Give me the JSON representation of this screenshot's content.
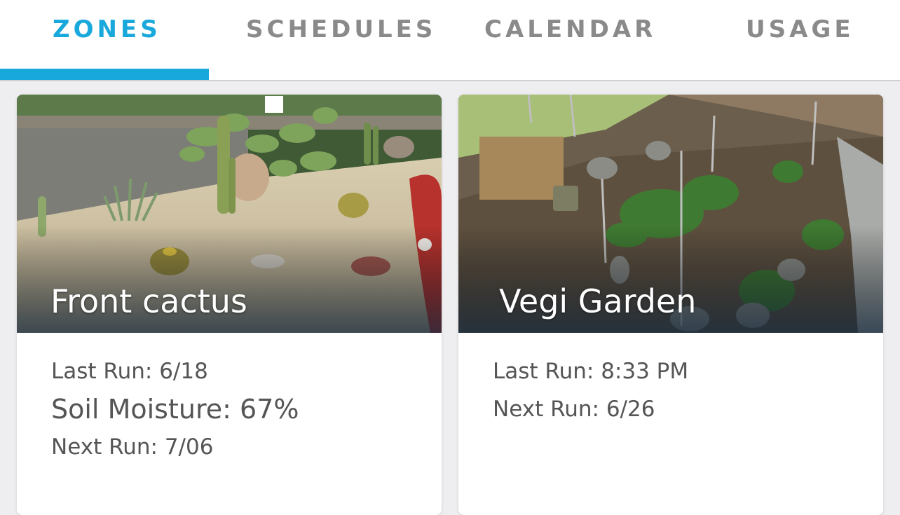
{
  "tabs": [
    {
      "label": "ZONES",
      "active": true
    },
    {
      "label": "SCHEDULES",
      "active": false
    },
    {
      "label": "CALENDAR",
      "active": false
    },
    {
      "label": "USAGE",
      "active": false
    }
  ],
  "colors": {
    "accent": "#18a8dc",
    "tab_inactive": "#8a8a8a",
    "info_text": "#555555",
    "background": "#eeeef0"
  },
  "zones": [
    {
      "name": "Front cactus",
      "image": "cactus-garden-photo",
      "last_run_label": "Last Run:",
      "last_run": "6/18",
      "soil_moisture_label": "Soil Moisture:",
      "soil_moisture": "67%",
      "next_run_label": "Next Run:",
      "next_run": "7/06"
    },
    {
      "name": "Vegi Garden",
      "image": "vegetable-garden-photo",
      "last_run_label": "Last Run:",
      "last_run": "8:33 PM",
      "next_run_label": "Next Run:",
      "next_run": "6/26"
    }
  ]
}
